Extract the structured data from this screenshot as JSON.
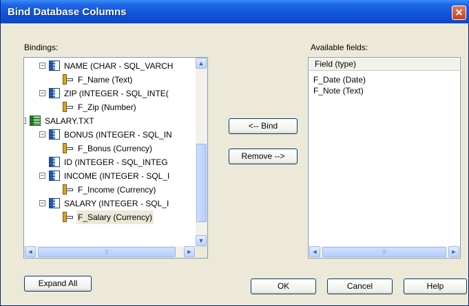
{
  "window": {
    "title": "Bind Database Columns",
    "close_glyph": "✕"
  },
  "bindings_label": "Bindings:",
  "available_label": "Available fields:",
  "tree": [
    {
      "label": "NAME (CHAR - SQL_VARCH",
      "icon": "table-column-icon",
      "expander": "−"
    },
    {
      "label": "F_Name (Text)",
      "icon": "bound-field-icon"
    },
    {
      "label": "ZIP (INTEGER - SQL_INTE(",
      "icon": "table-column-icon",
      "expander": "−"
    },
    {
      "label": "F_Zip (Number)",
      "icon": "bound-field-icon"
    },
    {
      "label": "SALARY.TXT",
      "icon": "table-icon",
      "expander": "−"
    },
    {
      "label": "BONUS (INTEGER - SQL_IN",
      "icon": "table-column-icon",
      "expander": "−"
    },
    {
      "label": "F_Bonus (Currency)",
      "icon": "bound-field-icon"
    },
    {
      "label": "ID (INTEGER - SQL_INTEG",
      "icon": "table-column-icon"
    },
    {
      "label": "INCOME (INTEGER - SQL_I",
      "icon": "table-column-icon",
      "expander": "−"
    },
    {
      "label": "F_Income (Currency)",
      "icon": "bound-field-icon"
    },
    {
      "label": "SALARY (INTEGER - SQL_I",
      "icon": "table-column-icon",
      "expander": "−"
    },
    {
      "label": "F_Salary (Currency)",
      "icon": "bound-field-icon",
      "selected": true
    }
  ],
  "scrollbar": {
    "up": "▲",
    "down": "▼",
    "left": "◄",
    "right": "►",
    "grip": "|||"
  },
  "buttons": {
    "bind": "<-- Bind",
    "remove": "Remove -->",
    "expand_all": "Expand All",
    "ok": "OK",
    "cancel": "Cancel",
    "help": "Help"
  },
  "available_fields": {
    "header": "Field (type)",
    "items": [
      "F_Date (Date)",
      "F_Note (Text)"
    ]
  }
}
